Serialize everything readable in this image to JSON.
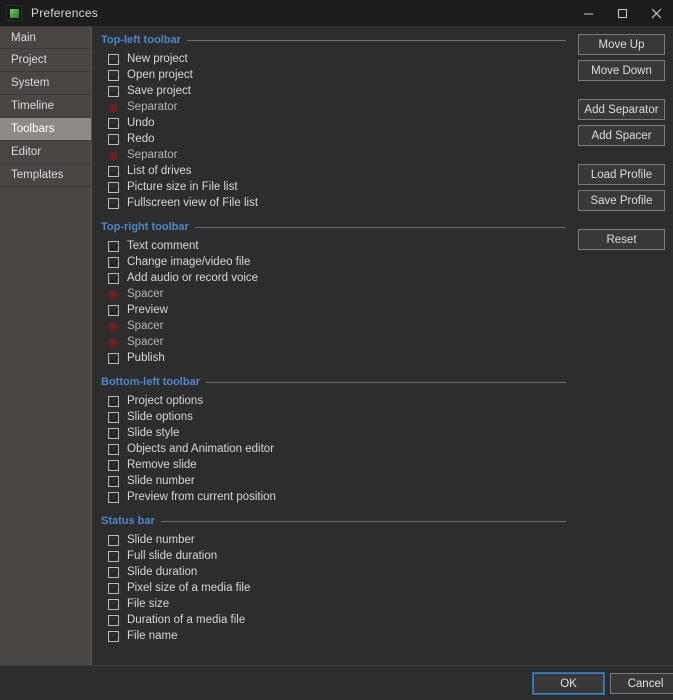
{
  "window": {
    "title": "Preferences",
    "icon": "app-icon",
    "controls": {
      "minimize": "minimize-icon",
      "maximize": "maximize-icon",
      "close": "close-icon"
    }
  },
  "sidebar": {
    "items": [
      {
        "label": "Main",
        "selected": false
      },
      {
        "label": "Project",
        "selected": false
      },
      {
        "label": "System",
        "selected": false
      },
      {
        "label": "Timeline",
        "selected": false
      },
      {
        "label": "Toolbars",
        "selected": true
      },
      {
        "label": "Editor",
        "selected": false
      },
      {
        "label": "Templates",
        "selected": false
      }
    ]
  },
  "sections": [
    {
      "title": "Top-left toolbar",
      "rows": [
        {
          "label": "New project",
          "type": "checkbox",
          "checked": true
        },
        {
          "label": "Open project",
          "type": "checkbox",
          "checked": true
        },
        {
          "label": "Save project",
          "type": "checkbox",
          "checked": true
        },
        {
          "label": "Separator",
          "type": "marker"
        },
        {
          "label": "Undo",
          "type": "checkbox",
          "checked": true
        },
        {
          "label": "Redo",
          "type": "checkbox",
          "checked": true
        },
        {
          "label": "Separator",
          "type": "marker"
        },
        {
          "label": "List of drives",
          "type": "checkbox",
          "checked": true
        },
        {
          "label": "Picture size in File list",
          "type": "checkbox",
          "checked": true
        },
        {
          "label": "Fullscreen view of File list",
          "type": "checkbox",
          "checked": true
        }
      ]
    },
    {
      "title": "Top-right toolbar",
      "rows": [
        {
          "label": "Text comment",
          "type": "checkbox",
          "checked": true
        },
        {
          "label": "Change image/video file",
          "type": "checkbox",
          "checked": true
        },
        {
          "label": "Add audio or record voice",
          "type": "checkbox",
          "checked": true
        },
        {
          "label": "Spacer",
          "type": "marker"
        },
        {
          "label": "Preview",
          "type": "checkbox",
          "checked": true
        },
        {
          "label": "Spacer",
          "type": "marker"
        },
        {
          "label": "Spacer",
          "type": "marker"
        },
        {
          "label": "Publish",
          "type": "checkbox",
          "checked": true
        }
      ]
    },
    {
      "title": "Bottom-left toolbar",
      "rows": [
        {
          "label": "Project options",
          "type": "checkbox",
          "checked": true
        },
        {
          "label": "Slide options",
          "type": "checkbox",
          "checked": true
        },
        {
          "label": "Slide style",
          "type": "checkbox",
          "checked": true
        },
        {
          "label": "Objects and Animation editor",
          "type": "checkbox",
          "checked": true
        },
        {
          "label": "Remove slide",
          "type": "checkbox",
          "checked": true
        },
        {
          "label": "Slide number",
          "type": "checkbox",
          "checked": true
        },
        {
          "label": "Preview from current position",
          "type": "checkbox",
          "checked": true
        }
      ]
    },
    {
      "title": "Status bar",
      "rows": [
        {
          "label": "Slide number",
          "type": "checkbox",
          "checked": true
        },
        {
          "label": "Full slide duration",
          "type": "checkbox",
          "checked": true
        },
        {
          "label": "Slide duration",
          "type": "checkbox",
          "checked": true
        },
        {
          "label": "Pixel size of a media file",
          "type": "checkbox",
          "checked": true
        },
        {
          "label": "File size",
          "type": "checkbox",
          "checked": true
        },
        {
          "label": "Duration of a media file",
          "type": "checkbox",
          "checked": true
        },
        {
          "label": "File name",
          "type": "checkbox",
          "checked": true
        }
      ]
    }
  ],
  "side_buttons": [
    {
      "label": "Move Up",
      "gap": "none"
    },
    {
      "label": "Move Down",
      "gap": "large"
    },
    {
      "label": "Add Separator",
      "gap": "none"
    },
    {
      "label": "Add Spacer",
      "gap": "large"
    },
    {
      "label": "Load Profile",
      "gap": "none"
    },
    {
      "label": "Save Profile",
      "gap": "large"
    },
    {
      "label": "Reset",
      "gap": "none"
    }
  ],
  "footer": {
    "ok_label": "OK",
    "cancel_label": "Cancel"
  },
  "colors": {
    "accent_blue": "#4d87c7",
    "window_bg": "#2d2d2d",
    "titlebar_bg": "#1c1c1c",
    "sidebar_bg": "#4a4543",
    "sidebar_selected": "#8f8a87",
    "marker_red": "#6e1f1f",
    "focus_border": "#3a7ebf"
  }
}
